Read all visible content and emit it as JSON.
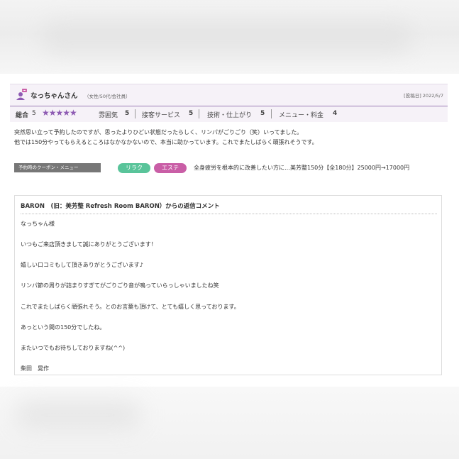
{
  "review": {
    "reviewer_name": "なっちゃんさん",
    "reviewer_meta": "（女性/50代/会社員）",
    "posted_date": "[投稿日] 2022/5/7",
    "overall_label": "総合",
    "overall_score": "5",
    "stars": "★★★★★",
    "ratings": [
      {
        "label": "雰囲気",
        "score": "5"
      },
      {
        "label": "接客サービス",
        "score": "5"
      },
      {
        "label": "技術・仕上がり",
        "score": "5"
      },
      {
        "label": "メニュー・料金",
        "score": "4"
      }
    ],
    "body_lines": [
      "突然思い立って予約したのですが、思ったよりひどい状態だったらしく、リンパがごりごり（笑）いってました。",
      "他では150分やってもらえるところはなかなかないので、本当に助かっています。これでまたしばらく頑張れそうです。"
    ]
  },
  "coupon": {
    "tag_label": "予約時のクーポン・メニュー",
    "pills": [
      "リラク",
      "エステ"
    ],
    "description": "全身疲労を根本的に改善したい方に…美芳整150分【全180分】25000円→17000円"
  },
  "reply": {
    "title": "BARON　(旧：美芳整 Refresh Room BARON）からの返信コメント",
    "lines": [
      "なっちゃん様",
      "いつもご来店頂きまして誠にありがとうございます！",
      "嬉しい口コミもして頂きありがとうございます♪",
      "リンパ節の周りが詰まりすぎてがごりごり音が鳴っていらっしゃいましたね笑",
      "これでまたしばらく頑張れそう。とのお言葉も頂けて、とても嬉しく思っております。",
      "あっという間の150分でしたね。",
      "またいつでもお待ちしておりますね(^^)",
      "柴田　晃作"
    ]
  },
  "colors": {
    "accent": "#8e5bb3",
    "relax_pill": "#59c49a",
    "esthe_pill": "#c95ea6",
    "coupon_tag": "#777777"
  },
  "icons": {
    "avatar": "user-avatar-icon"
  }
}
